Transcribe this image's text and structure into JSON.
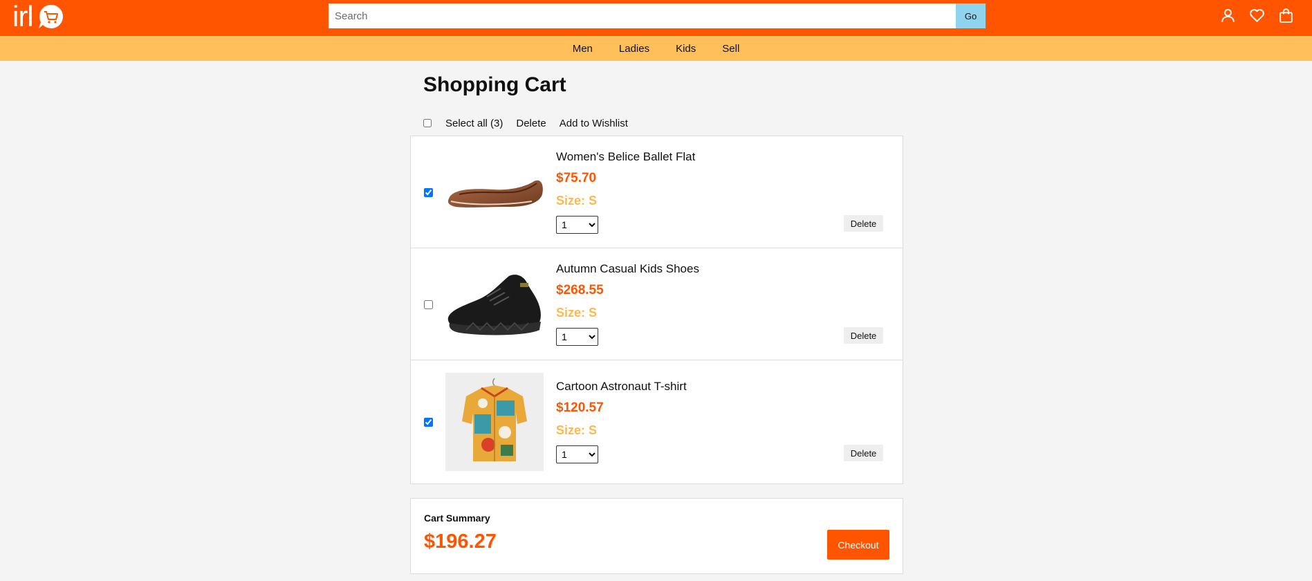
{
  "header": {
    "logo_text": "irl",
    "search": {
      "placeholder": "Search",
      "value": "",
      "go_label": "Go"
    },
    "icons": [
      "user-icon",
      "heart-icon",
      "bag-icon"
    ]
  },
  "categories": [
    "Men",
    "Ladies",
    "Kids",
    "Sell"
  ],
  "page": {
    "title": "Shopping Cart"
  },
  "bulk_actions": {
    "select_all_label": "Select all (3)",
    "delete_label": "Delete",
    "wishlist_label": "Add to Wishlist",
    "select_all_checked": false
  },
  "cart_items": [
    {
      "name": "Women's Belice Ballet Flat",
      "price": "$75.70",
      "size": "Size: S",
      "qty": "1",
      "checked": true,
      "delete_label": "Delete",
      "image_icon": "ballet-flat-image"
    },
    {
      "name": "Autumn Casual Kids Shoes",
      "price": "$268.55",
      "size": "Size: S",
      "qty": "1",
      "checked": false,
      "delete_label": "Delete",
      "image_icon": "sneaker-image"
    },
    {
      "name": "Cartoon Astronaut T-shirt",
      "price": "$120.57",
      "size": "Size: S",
      "qty": "1",
      "checked": true,
      "delete_label": "Delete",
      "image_icon": "shirt-image"
    }
  ],
  "summary": {
    "label": "Cart Summary",
    "total": "$196.27",
    "checkout_label": "Checkout"
  },
  "colors": {
    "brand": "#ff5500",
    "category_bar": "#ffbf5a",
    "size_text": "#ffb84d",
    "go_button": "#8fd3ec"
  }
}
